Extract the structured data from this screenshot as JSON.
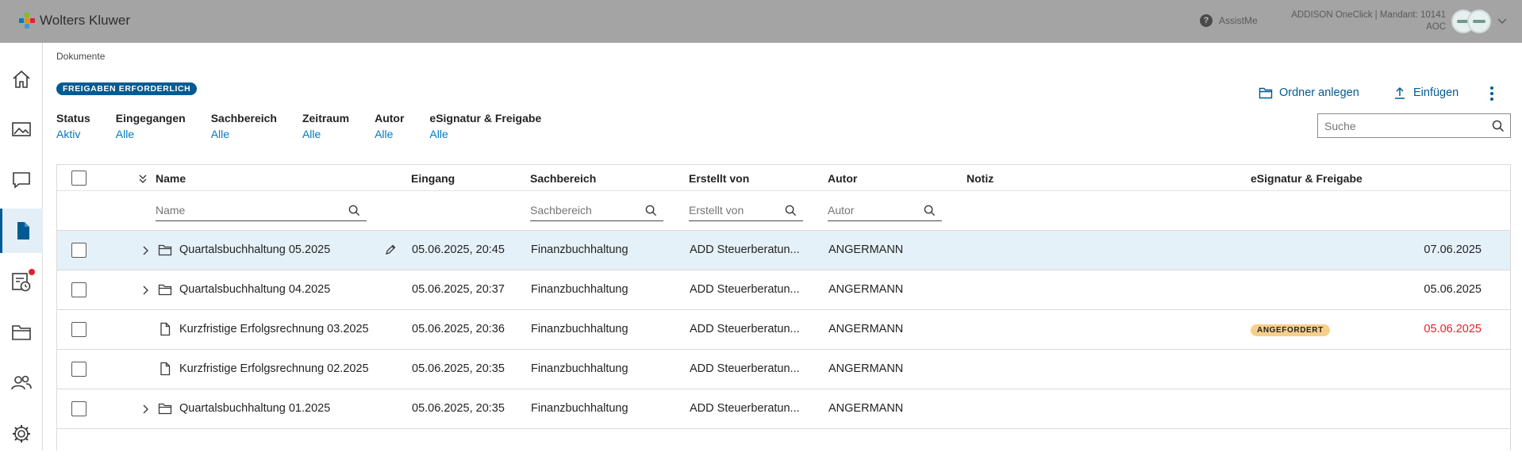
{
  "topbar": {
    "brand": "Wolters Kluwer",
    "assist": "AssistMe",
    "mandant_line1": "ADDISON OneClick | Mandant: 10141",
    "mandant_line2": "AOC"
  },
  "sidebar": {
    "items": [
      {
        "name": "home",
        "icon": "home-icon"
      },
      {
        "name": "images",
        "icon": "image-icon"
      },
      {
        "name": "messages",
        "icon": "chat-icon"
      },
      {
        "name": "documents",
        "icon": "document-icon",
        "active": true
      },
      {
        "name": "tasks",
        "icon": "task-clock-icon",
        "notification": true
      },
      {
        "name": "folders",
        "icon": "folder-icon"
      },
      {
        "name": "users",
        "icon": "users-icon"
      },
      {
        "name": "settings",
        "icon": "gear-icon"
      }
    ]
  },
  "breadcrumb": "Dokumente",
  "badge": "FREIGABEN ERFORDERLICH",
  "filters": [
    {
      "label": "Status",
      "value": "Aktiv"
    },
    {
      "label": "Eingegangen",
      "value": "Alle"
    },
    {
      "label": "Sachbereich",
      "value": "Alle"
    },
    {
      "label": "Zeitraum",
      "value": "Alle"
    },
    {
      "label": "Autor",
      "value": "Alle"
    },
    {
      "label": "eSignatur & Freigabe",
      "value": "Alle"
    }
  ],
  "actions": {
    "new_folder": "Ordner anlegen",
    "insert": "Einfügen"
  },
  "search": {
    "placeholder": "Suche"
  },
  "table": {
    "columns": {
      "name": "Name",
      "eingang": "Eingang",
      "sachbereich": "Sachbereich",
      "erstellt_von": "Erstellt von",
      "autor": "Autor",
      "notiz": "Notiz",
      "esignatur": "eSignatur & Freigabe"
    },
    "filter_placeholders": {
      "name": "Name",
      "sachbereich": "Sachbereich",
      "erstellt_von": "Erstellt von",
      "autor": "Autor"
    },
    "rows": [
      {
        "type": "folder",
        "name": "Quartalsbuchhaltung 05.2025",
        "eingang": "05.06.2025, 20:45",
        "sachbereich": "Finanzbuchhaltung",
        "erstellt_von": "ADD Steuerberatun...",
        "autor": "ANGERMANN",
        "status": "",
        "date": "07.06.2025",
        "selected": true
      },
      {
        "type": "folder",
        "name": "Quartalsbuchhaltung 04.2025",
        "eingang": "05.06.2025, 20:37",
        "sachbereich": "Finanzbuchhaltung",
        "erstellt_von": "ADD Steuerberatun...",
        "autor": "ANGERMANN",
        "status": "",
        "date": "05.06.2025"
      },
      {
        "type": "file",
        "name": "Kurzfristige Erfolgsrechnung 03.2025",
        "eingang": "05.06.2025, 20:36",
        "sachbereich": "Finanzbuchhaltung",
        "erstellt_von": "ADD Steuerberatun...",
        "autor": "ANGERMANN",
        "status": "ANGEFORDERT",
        "date": "05.06.2025",
        "date_color": "#e5202e"
      },
      {
        "type": "file",
        "name": "Kurzfristige Erfolgsrechnung 02.2025",
        "eingang": "05.06.2025, 20:35",
        "sachbereich": "Finanzbuchhaltung",
        "erstellt_von": "ADD Steuerberatun...",
        "autor": "ANGERMANN",
        "status": "",
        "date": ""
      },
      {
        "type": "folder",
        "name": "Quartalsbuchhaltung 01.2025",
        "eingang": "05.06.2025, 20:35",
        "sachbereich": "Finanzbuchhaltung",
        "erstellt_von": "ADD Steuerberatun...",
        "autor": "ANGERMANN",
        "status": "",
        "date": ""
      }
    ]
  },
  "colors": {
    "accent": "#005b92",
    "link": "#007ac3",
    "selected_row": "#e5f1f9",
    "warning_pill": "#f7cf8d",
    "due_red": "#e5202e"
  }
}
